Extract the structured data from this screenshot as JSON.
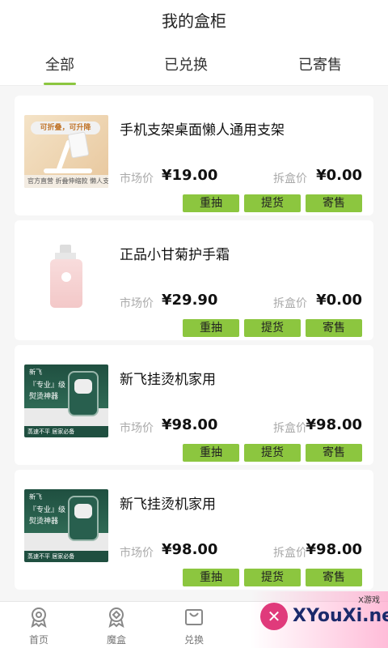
{
  "header": {
    "title": "我的盒柜",
    "tabs": [
      {
        "label": "全部",
        "active": true
      },
      {
        "label": "已兑换",
        "active": false
      },
      {
        "label": "已寄售",
        "active": false
      }
    ]
  },
  "colors": {
    "accent": "#8cc63f"
  },
  "items": [
    {
      "name": "手机支架桌面懒人通用支架",
      "market_label": "市场价",
      "market_price": "¥19.00",
      "box_label": "拆盒价",
      "box_price": "¥0.00",
      "thumb_text_top": "可折叠，可升降",
      "thumb_text_bottom": "官方直营 折叠伸缩款 懒人支架"
    },
    {
      "name": "正品小甘菊护手霜",
      "market_label": "市场价",
      "market_price": "¥29.90",
      "box_label": "拆盒价",
      "box_price": "¥0.00"
    },
    {
      "name": "新飞挂烫机家用",
      "market_label": "市场价",
      "market_price": "¥98.00",
      "box_label": "拆盒价",
      "box_price": "¥98.00",
      "thumb_brand": "新飞",
      "thumb_line1": "『专业』级",
      "thumb_line2": "熨烫神器",
      "thumb_foot": "蒸速不平 居家必备"
    },
    {
      "name": "新飞挂烫机家用",
      "market_label": "市场价",
      "market_price": "¥98.00",
      "box_label": "拆盒价",
      "box_price": "¥98.00",
      "thumb_brand": "新飞",
      "thumb_line1": "『专业』级",
      "thumb_line2": "熨烫神器",
      "thumb_foot": "蒸速不平 居家必备"
    }
  ],
  "buttons": {
    "redraw": "重抽",
    "pickup": "提货",
    "consign": "寄售"
  },
  "bottom_nav": [
    {
      "label": "首页",
      "icon": "home-medal-icon"
    },
    {
      "label": "魔盒",
      "icon": "magic-box-icon"
    },
    {
      "label": "兑换",
      "icon": "shopping-bag-icon"
    }
  ],
  "watermark": {
    "brand": "XYouXi.net",
    "small": "X游戏"
  }
}
